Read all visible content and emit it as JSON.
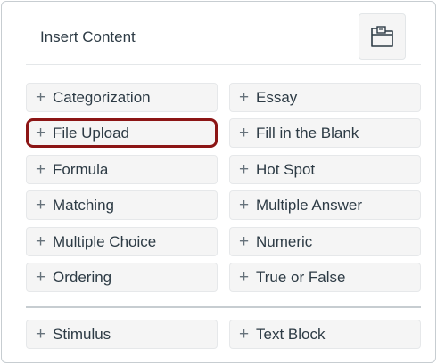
{
  "header": {
    "title": "Insert Content",
    "folder_icon": "folder-open-icon"
  },
  "plus_glyph": "+",
  "items": [
    {
      "label": "Categorization"
    },
    {
      "label": "Essay"
    },
    {
      "label": "File Upload",
      "selected": true
    },
    {
      "label": "Fill in the Blank"
    },
    {
      "label": "Formula"
    },
    {
      "label": "Hot Spot"
    },
    {
      "label": "Matching"
    },
    {
      "label": "Multiple Answer"
    },
    {
      "label": "Multiple Choice"
    },
    {
      "label": "Numeric"
    },
    {
      "label": "Ordering"
    },
    {
      "label": "True or False"
    }
  ],
  "other_items": [
    {
      "label": "Stimulus"
    },
    {
      "label": "Text Block"
    }
  ],
  "colors": {
    "selected_border": "#8c1515",
    "button_bg": "#f5f5f5",
    "text": "#2d3b45"
  }
}
